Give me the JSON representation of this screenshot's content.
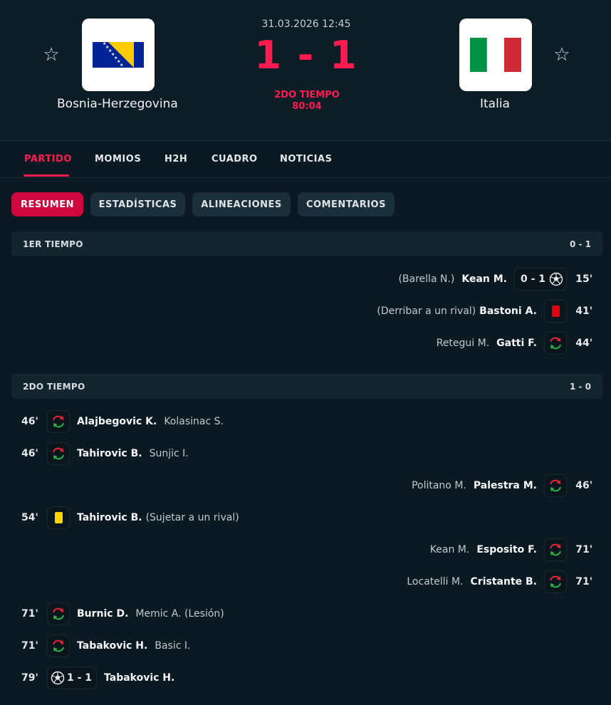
{
  "match": {
    "datetime": "31.03.2026 12:45",
    "score": "1 - 1",
    "period": "2DO TIEMPO",
    "clock": "80:04",
    "home": {
      "name": "Bosnia-Herzegovina",
      "flag_icon": "bosnia-flag-icon"
    },
    "away": {
      "name": "Italia",
      "flag_icon": "italy-flag-icon"
    },
    "favorite_icon": "☆"
  },
  "tabs": [
    "PARTIDO",
    "MOMIOS",
    "H2H",
    "CUADRO",
    "NOTICIAS"
  ],
  "subtabs": [
    "RESUMEN",
    "ESTADÍSTICAS",
    "ALINEACIONES",
    "COMENTARIOS"
  ],
  "periods": [
    {
      "name": "1ER TIEMPO",
      "score": "0 - 1"
    },
    {
      "name": "2DO TIEMPO",
      "score": "1 - 0"
    }
  ],
  "incidents_first": [
    {
      "minute": "15'",
      "assist": "(Barella N.)",
      "player": "Kean M.",
      "score": "0 - 1",
      "icon": "soccer-ball-icon"
    },
    {
      "minute": "41'",
      "note": "(Derribar a un rival)",
      "player": "Bastoni A.",
      "icon": "red-card-icon"
    },
    {
      "minute": "44'",
      "out": "Retegui M.",
      "player": "Gatti F.",
      "icon": "substitution-icon"
    }
  ],
  "incidents_second": [
    {
      "minute": "46'",
      "player": "Alajbegovic K.",
      "other": "Kolasinac S.",
      "icon": "substitution-icon"
    },
    {
      "minute": "46'",
      "player": "Tahirovic B.",
      "other": "Sunjic I.",
      "icon": "substitution-icon"
    },
    {
      "minute": "46'",
      "player": "Palestra M.",
      "other": "Politano M.",
      "icon": "substitution-icon"
    },
    {
      "minute": "54'",
      "player": "Tahirovic B.",
      "other": "(Sujetar a un rival)",
      "icon": "yellow-card-icon"
    },
    {
      "minute": "71'",
      "player": "Esposito F.",
      "other": "Kean M.",
      "icon": "substitution-icon"
    },
    {
      "minute": "71'",
      "player": "Cristante B.",
      "other": "Locatelli M.",
      "icon": "substitution-icon"
    },
    {
      "minute": "71'",
      "player": "Burnic D.",
      "other": "Memic A. (Lesión)",
      "icon": "substitution-icon"
    },
    {
      "minute": "71'",
      "player": "Tabakovic H.",
      "other": "Basic I.",
      "icon": "substitution-icon"
    },
    {
      "minute": "79'",
      "player": "Tabakovic H.",
      "score": "1 - 1",
      "icon": "soccer-ball-icon"
    }
  ],
  "colors": {
    "accent": "#ff1a50",
    "background": "#0b1a22",
    "card_red": "#e3000f",
    "card_yellow": "#ffd400"
  }
}
